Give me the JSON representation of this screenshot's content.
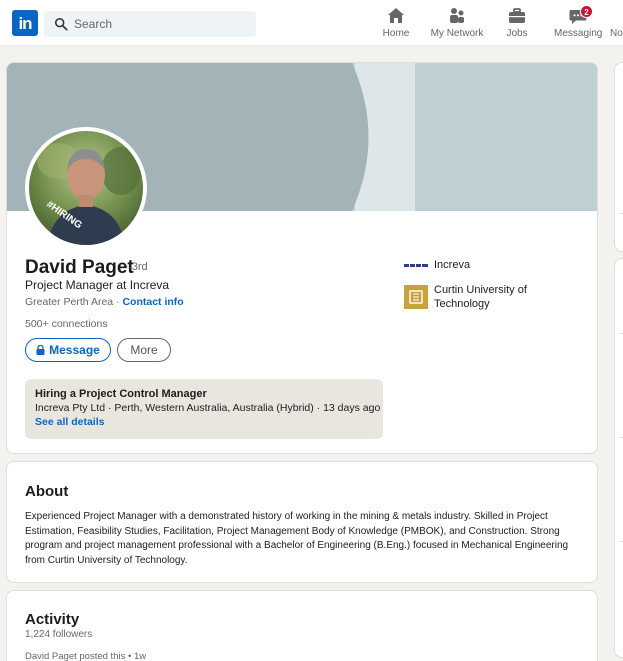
{
  "nav": {
    "logo": "in",
    "search_placeholder": "Search",
    "items": [
      {
        "label": "Home"
      },
      {
        "label": "My Network"
      },
      {
        "label": "Jobs"
      },
      {
        "label": "Messaging",
        "badge": "2"
      },
      {
        "label": "No"
      }
    ]
  },
  "profile": {
    "name": "David Paget",
    "degree": "· 3rd",
    "headline": "Project Manager at Increva",
    "location": "Greater Perth Area · ",
    "contact_info": "Contact info",
    "connections": "500+ connections",
    "message_button": "Message",
    "more_button": "More",
    "avatar_frame": "#HIRING",
    "orgs": [
      {
        "name": "Increva"
      },
      {
        "name": "Curtin University of Technology"
      }
    ],
    "hiring": {
      "title": "Hiring a Project Control Manager",
      "detail": "Increva Pty Ltd · Perth, Western Australia, Australia (Hybrid) · 13 days ago",
      "link": "See all details"
    }
  },
  "about": {
    "title": "About",
    "text": "Experienced Project Manager with a demonstrated history of working in the mining & metals industry. Skilled in Project Estimation, Feasibility Studies, Facilitation, Project Management Body of Knowledge (PMBOK), and Construction. Strong program and project management professional with a Bachelor of Engineering (B.Eng.) focused in Mechanical Engineering from Curtin University of Technology."
  },
  "activity": {
    "title": "Activity",
    "followers": "1,224 followers",
    "post_meta": "David Paget posted this • 1w"
  },
  "colors": {
    "brand": "#0a66c2",
    "badge": "#cb112d",
    "hiring_purple": "#7c3fc1",
    "page_bg": "#f4f2ee"
  }
}
